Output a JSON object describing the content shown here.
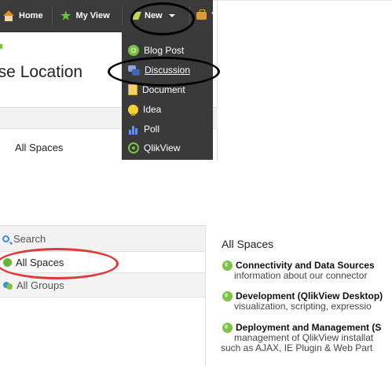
{
  "navbar": {
    "home_label": "Home",
    "myview_label": "My View",
    "new_label": "New",
    "truncated_label": "Y"
  },
  "new_menu": {
    "items": [
      {
        "label": "Blog Post",
        "icon": "blog-post-icon"
      },
      {
        "label": "Discussion",
        "icon": "discussion-icon"
      },
      {
        "label": "Document",
        "icon": "document-icon"
      },
      {
        "label": "Idea",
        "icon": "idea-icon"
      },
      {
        "label": "Poll",
        "icon": "poll-icon"
      },
      {
        "label": "QlikView",
        "icon": "qlikview-icon"
      }
    ]
  },
  "page": {
    "heading": "ose Location",
    "upper_all_spaces": "All Spaces"
  },
  "chooser": {
    "sidebar": {
      "search": "Search",
      "all_spaces": "All Spaces",
      "all_groups": "All Groups"
    },
    "main": {
      "heading": "All Spaces",
      "spaces": [
        {
          "title": "Connectivity and Data Sources",
          "desc_line1": "information about our connector"
        },
        {
          "title": "Development (QlikView Desktop)",
          "desc_line1": "visualization, scripting, expressio"
        },
        {
          "title": "Deployment and Management (S",
          "desc_line1": "management of QlikView installat",
          "desc_line2": "such as AJAX, IE Plugin & Web Part"
        }
      ]
    }
  },
  "colors": {
    "navbar_bg": "#3b3b3b",
    "annotation_black": "#000000",
    "annotation_red": "#de3a3a",
    "accent_green": "#7cc243"
  }
}
